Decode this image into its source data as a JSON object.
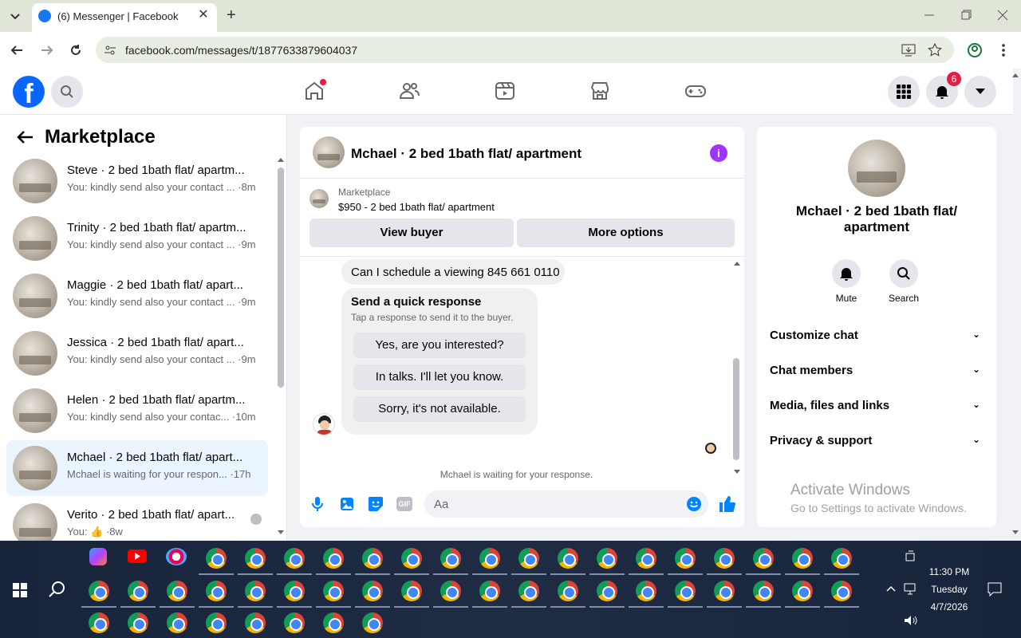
{
  "browser": {
    "tab_title": "(6) Messenger | Facebook",
    "url": "facebook.com/messages/t/1877633879604037"
  },
  "header": {
    "notification_count": "6"
  },
  "left_panel": {
    "title": "Marketplace",
    "conversations": [
      {
        "name": "Steve · 2 bed 1bath flat/ apartm...",
        "preview": "You: kindly send also your contact ... ·8m"
      },
      {
        "name": "Trinity · 2 bed 1bath flat/ apartm...",
        "preview": "You: kindly send also your contact ... ·9m"
      },
      {
        "name": "Maggie · 2 bed 1bath flat/ apart...",
        "preview": "You: kindly send also your contact ... ·9m"
      },
      {
        "name": "Jessica · 2 bed 1bath flat/ apart...",
        "preview": "You: kindly send also your contact ... ·9m"
      },
      {
        "name": "Helen · 2 bed 1bath flat/ apartm...",
        "preview": "You: kindly send also your contac... ·10m"
      },
      {
        "name": "Mchael · 2 bed 1bath flat/ apart...",
        "preview": "Mchael is waiting for your respon... ·17h"
      },
      {
        "name": "Verito · 2 bed 1bath flat/ apart...",
        "preview": "You: 👍 ·8w"
      }
    ]
  },
  "chat": {
    "title": "Mchael · 2 bed 1bath flat/ apartment",
    "marketplace_label": "Marketplace",
    "listing": "$950 - 2 bed 1bath flat/ apartment",
    "view_buyer": "View buyer",
    "more_options": "More options",
    "message": "Can I schedule a viewing 845 661 0110",
    "quick_title": "Send a quick response",
    "quick_sub": "Tap a response to send it to the buyer.",
    "quick_replies": [
      "Yes, are you interested?",
      "In talks. I'll let you know.",
      "Sorry, it's not available."
    ],
    "waiting": "Mchael is waiting for your response.",
    "composer_placeholder": "Aa"
  },
  "right_panel": {
    "name": "Mchael · 2 bed 1bath flat/ apartment",
    "mute": "Mute",
    "search": "Search",
    "rows": [
      "Customize chat",
      "Chat members",
      "Media, files and links",
      "Privacy & support"
    ]
  },
  "watermark": {
    "line1": "Activate Windows",
    "line2": "Go to Settings to activate Windows."
  },
  "taskbar": {
    "time": "11:30 PM",
    "day": "Tuesday",
    "date": "4/7/2026"
  },
  "colors": {
    "fb_blue": "#0866ff",
    "messenger_blue": "#0084ff",
    "badge_red": "#e41e3f",
    "info_purple": "#a033ff"
  }
}
